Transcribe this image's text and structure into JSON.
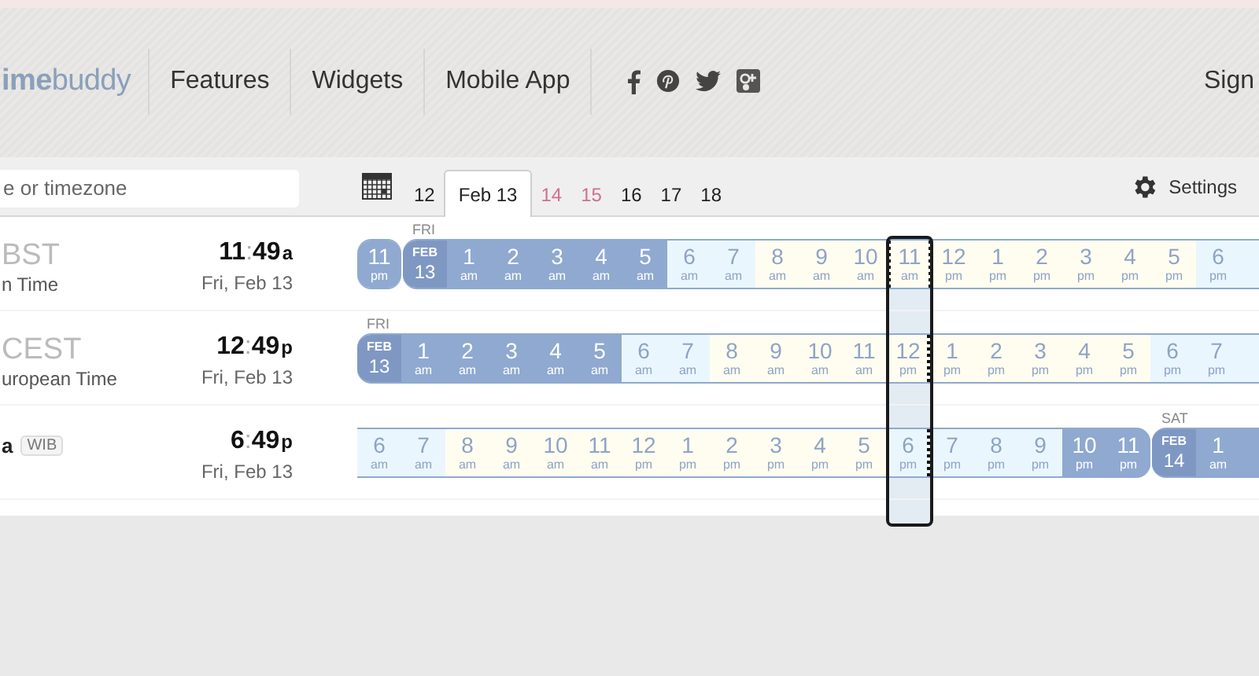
{
  "header": {
    "logo": "**ime**buddy",
    "nav": [
      "Features",
      "Widgets",
      "Mobile App"
    ],
    "sign_in": "Sign"
  },
  "toolbar": {
    "search": {
      "placeholder": "e or timezone"
    },
    "dates": [
      {
        "label": "12",
        "selected": false,
        "weekend": false
      },
      {
        "label": "Feb 13",
        "selected": true,
        "weekend": false
      },
      {
        "label": "14",
        "selected": false,
        "weekend": true
      },
      {
        "label": "15",
        "selected": false,
        "weekend": true
      },
      {
        "label": "16",
        "selected": false,
        "weekend": false
      },
      {
        "label": "17",
        "selected": false,
        "weekend": false
      },
      {
        "label": "18",
        "selected": false,
        "weekend": false
      }
    ],
    "settings": "Settings"
  },
  "rows": [
    {
      "abbr": "BST",
      "name": "n Time",
      "time": {
        "hours": "11",
        "sep": ":",
        "minutes": "49",
        "suffix": "a"
      },
      "date": "Fri, Feb 13",
      "segments": [
        {
          "cells": [
            {
              "kind": "night",
              "num": "11",
              "period": "pm",
              "selected": false
            }
          ]
        },
        {
          "weekday": "FRI",
          "cells": [
            {
              "kind": "date",
              "month": "FEB",
              "day": "13",
              "selected": false
            },
            {
              "kind": "night",
              "num": "1",
              "period": "am",
              "selected": false
            },
            {
              "kind": "night",
              "num": "2",
              "period": "am",
              "selected": false
            },
            {
              "kind": "night",
              "num": "3",
              "period": "am",
              "selected": false
            },
            {
              "kind": "night",
              "num": "4",
              "period": "am",
              "selected": false
            },
            {
              "kind": "night",
              "num": "5",
              "period": "am",
              "selected": false
            },
            {
              "kind": "twilight",
              "num": "6",
              "period": "am",
              "selected": false
            },
            {
              "kind": "twilight",
              "num": "7",
              "period": "am",
              "selected": false
            },
            {
              "kind": "day",
              "num": "8",
              "period": "am",
              "selected": false
            },
            {
              "kind": "day",
              "num": "9",
              "period": "am",
              "selected": false
            },
            {
              "kind": "day",
              "num": "10",
              "period": "am",
              "selected": false
            },
            {
              "kind": "day",
              "num": "11",
              "period": "am",
              "selected": true
            },
            {
              "kind": "day",
              "num": "12",
              "period": "pm",
              "selected": false
            },
            {
              "kind": "day",
              "num": "1",
              "period": "pm",
              "selected": false
            },
            {
              "kind": "day",
              "num": "2",
              "period": "pm",
              "selected": false
            },
            {
              "kind": "day",
              "num": "3",
              "period": "pm",
              "selected": false
            },
            {
              "kind": "day",
              "num": "4",
              "period": "pm",
              "selected": false
            },
            {
              "kind": "day",
              "num": "5",
              "period": "pm",
              "selected": false
            },
            {
              "kind": "twilight",
              "num": "6",
              "period": "pm",
              "selected": false
            }
          ]
        }
      ]
    },
    {
      "abbr": "CEST",
      "name": "uropean Time",
      "time": {
        "hours": "12",
        "sep": ":",
        "minutes": "49",
        "suffix": "p"
      },
      "date": "Fri, Feb 13",
      "segments": [
        {
          "weekday": "FRI",
          "cells": [
            {
              "kind": "date",
              "month": "FEB",
              "day": "13",
              "selected": false
            },
            {
              "kind": "night",
              "num": "1",
              "period": "am",
              "selected": false
            },
            {
              "kind": "night",
              "num": "2",
              "period": "am",
              "selected": false
            },
            {
              "kind": "night",
              "num": "3",
              "period": "am",
              "selected": false
            },
            {
              "kind": "night",
              "num": "4",
              "period": "am",
              "selected": false
            },
            {
              "kind": "night",
              "num": "5",
              "period": "am",
              "selected": false
            },
            {
              "kind": "twilight",
              "num": "6",
              "period": "am",
              "selected": false
            },
            {
              "kind": "twilight",
              "num": "7",
              "period": "am",
              "selected": false
            },
            {
              "kind": "day",
              "num": "8",
              "period": "am",
              "selected": false
            },
            {
              "kind": "day",
              "num": "9",
              "period": "am",
              "selected": false
            },
            {
              "kind": "day",
              "num": "10",
              "period": "am",
              "selected": false
            },
            {
              "kind": "day",
              "num": "11",
              "period": "am",
              "selected": false
            },
            {
              "kind": "day",
              "num": "12",
              "period": "pm",
              "selected": true
            },
            {
              "kind": "day",
              "num": "1",
              "period": "pm",
              "selected": false
            },
            {
              "kind": "day",
              "num": "2",
              "period": "pm",
              "selected": false
            },
            {
              "kind": "day",
              "num": "3",
              "period": "pm",
              "selected": false
            },
            {
              "kind": "day",
              "num": "4",
              "period": "pm",
              "selected": false
            },
            {
              "kind": "day",
              "num": "5",
              "period": "pm",
              "selected": false
            },
            {
              "kind": "twilight",
              "num": "6",
              "period": "pm",
              "selected": false
            },
            {
              "kind": "twilight",
              "num": "7",
              "period": "pm",
              "selected": false
            }
          ]
        }
      ]
    },
    {
      "abbr": "a",
      "badge": "WIB",
      "time": {
        "hours": "6",
        "sep": ":",
        "minutes": "49",
        "suffix": "p"
      },
      "date": "Fri, Feb 13",
      "segments": [
        {
          "cells": [
            {
              "kind": "twilight",
              "num": "6",
              "period": "am",
              "selected": false
            },
            {
              "kind": "twilight",
              "num": "7",
              "period": "am",
              "selected": false
            },
            {
              "kind": "day",
              "num": "8",
              "period": "am",
              "selected": false
            },
            {
              "kind": "day",
              "num": "9",
              "period": "am",
              "selected": false
            },
            {
              "kind": "day",
              "num": "10",
              "period": "am",
              "selected": false
            },
            {
              "kind": "day",
              "num": "11",
              "period": "am",
              "selected": false
            },
            {
              "kind": "day",
              "num": "12",
              "period": "pm",
              "selected": false
            },
            {
              "kind": "day",
              "num": "1",
              "period": "pm",
              "selected": false
            },
            {
              "kind": "day",
              "num": "2",
              "period": "pm",
              "selected": false
            },
            {
              "kind": "day",
              "num": "3",
              "period": "pm",
              "selected": false
            },
            {
              "kind": "day",
              "num": "4",
              "period": "pm",
              "selected": false
            },
            {
              "kind": "day",
              "num": "5",
              "period": "pm",
              "selected": false
            },
            {
              "kind": "twilight",
              "num": "6",
              "period": "pm",
              "selected": true
            },
            {
              "kind": "twilight",
              "num": "7",
              "period": "pm",
              "selected": false
            },
            {
              "kind": "twilight",
              "num": "8",
              "period": "pm",
              "selected": false
            },
            {
              "kind": "twilight",
              "num": "9",
              "period": "pm",
              "selected": false
            },
            {
              "kind": "night",
              "num": "10",
              "period": "pm",
              "selected": false
            },
            {
              "kind": "night",
              "num": "11",
              "period": "pm",
              "selected": false
            }
          ]
        },
        {
          "weekday": "SAT",
          "cells": [
            {
              "kind": "date",
              "month": "FEB",
              "day": "14",
              "selected": false
            },
            {
              "kind": "night",
              "num": "1",
              "period": "am",
              "selected": false
            }
          ]
        }
      ]
    }
  ]
}
